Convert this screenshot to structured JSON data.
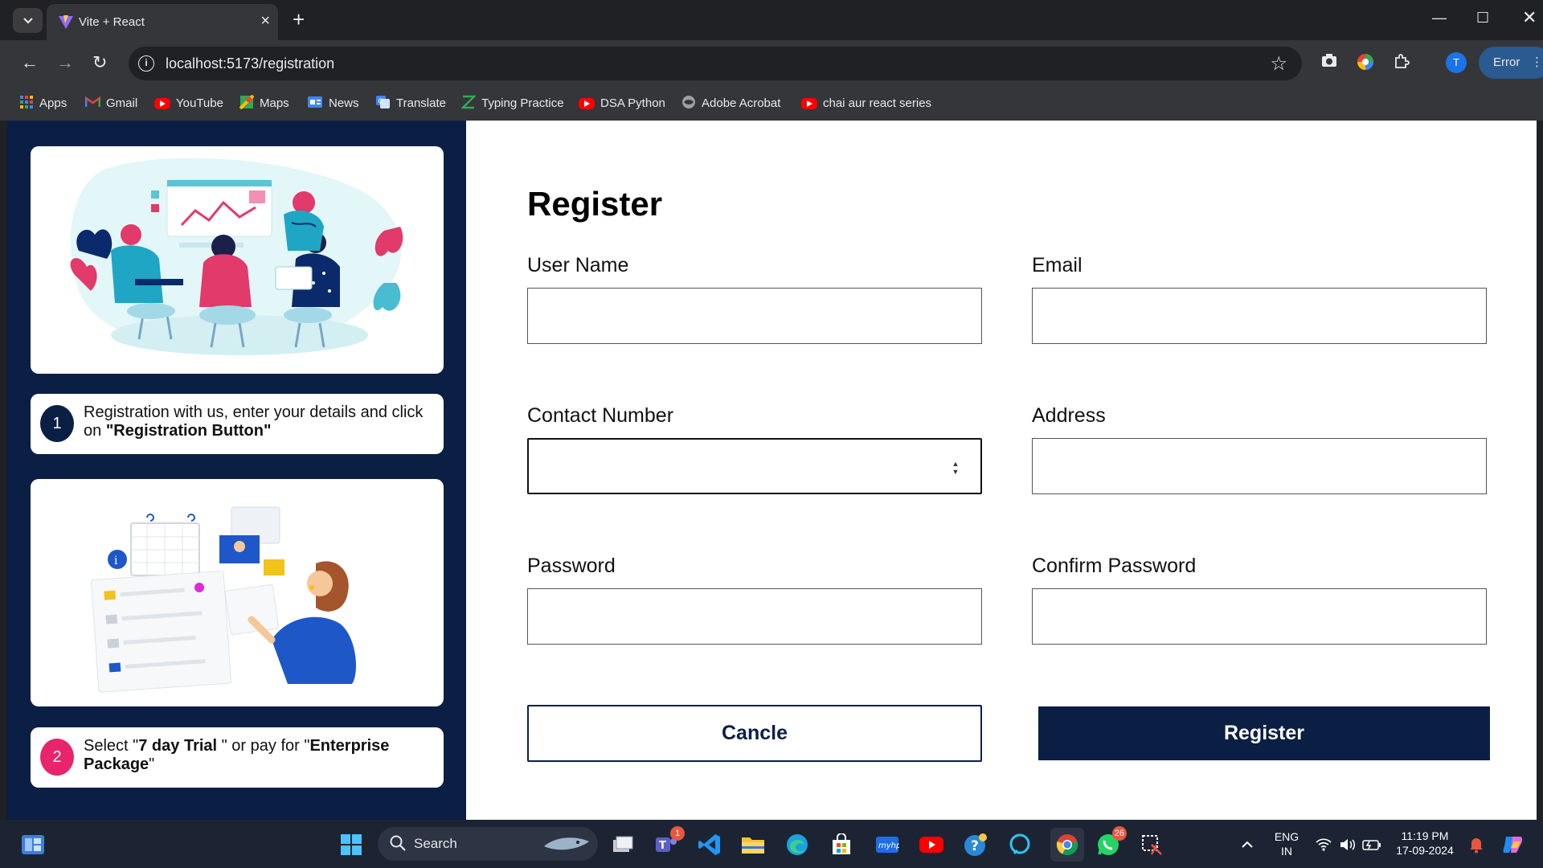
{
  "browser": {
    "tab": {
      "title": "Vite + React"
    },
    "url": "localhost:5173/registration",
    "profile_initial": "T",
    "error_label": "Error",
    "bookmarks": [
      {
        "label": "Apps",
        "icon": "apps-grid-icon"
      },
      {
        "label": "Gmail",
        "icon": "gmail-icon"
      },
      {
        "label": "YouTube",
        "icon": "youtube-icon"
      },
      {
        "label": "Maps",
        "icon": "maps-icon"
      },
      {
        "label": "News",
        "icon": "news-icon"
      },
      {
        "label": "Translate",
        "icon": "translate-icon"
      },
      {
        "label": "Typing Practice",
        "icon": "typing-icon"
      },
      {
        "label": "DSA Python",
        "icon": "youtube-icon"
      },
      {
        "label": "Adobe Acrobat",
        "icon": "globe-icon"
      },
      {
        "label": "chai aur react series",
        "icon": "youtube-icon"
      }
    ]
  },
  "sidebar": {
    "step1": {
      "number": "1",
      "text_before": "Registration with us, enter your details and click on ",
      "text_bold": "\"Registration Button\"",
      "color": "#0b1f45"
    },
    "step2": {
      "number": "2",
      "text_a": "Select \"",
      "text_b": "7 day Trial",
      "text_c": " \" or pay for \"",
      "text_d": "Enterprise Package",
      "text_e": "\"",
      "color": "#e8246c"
    }
  },
  "form": {
    "title": "Register",
    "fields": {
      "username": {
        "label": "User Name",
        "value": ""
      },
      "email": {
        "label": "Email",
        "value": ""
      },
      "contact": {
        "label": "Contact Number",
        "value": ""
      },
      "address": {
        "label": "Address",
        "value": ""
      },
      "password": {
        "label": "Password",
        "value": ""
      },
      "confirm_password": {
        "label": "Confirm Password",
        "value": ""
      }
    },
    "cancel_label": "Cancle",
    "register_label": "Register"
  },
  "taskbar": {
    "search_label": "Search",
    "teams_badge": "1",
    "whatsapp_badge": "26",
    "lang_line1": "ENG",
    "lang_line2": "IN",
    "time": "11:19 PM",
    "date": "17-09-2024"
  },
  "colors": {
    "navy": "#0b1f45",
    "accent_pink": "#e8246c",
    "chrome_dark": "#202124"
  }
}
